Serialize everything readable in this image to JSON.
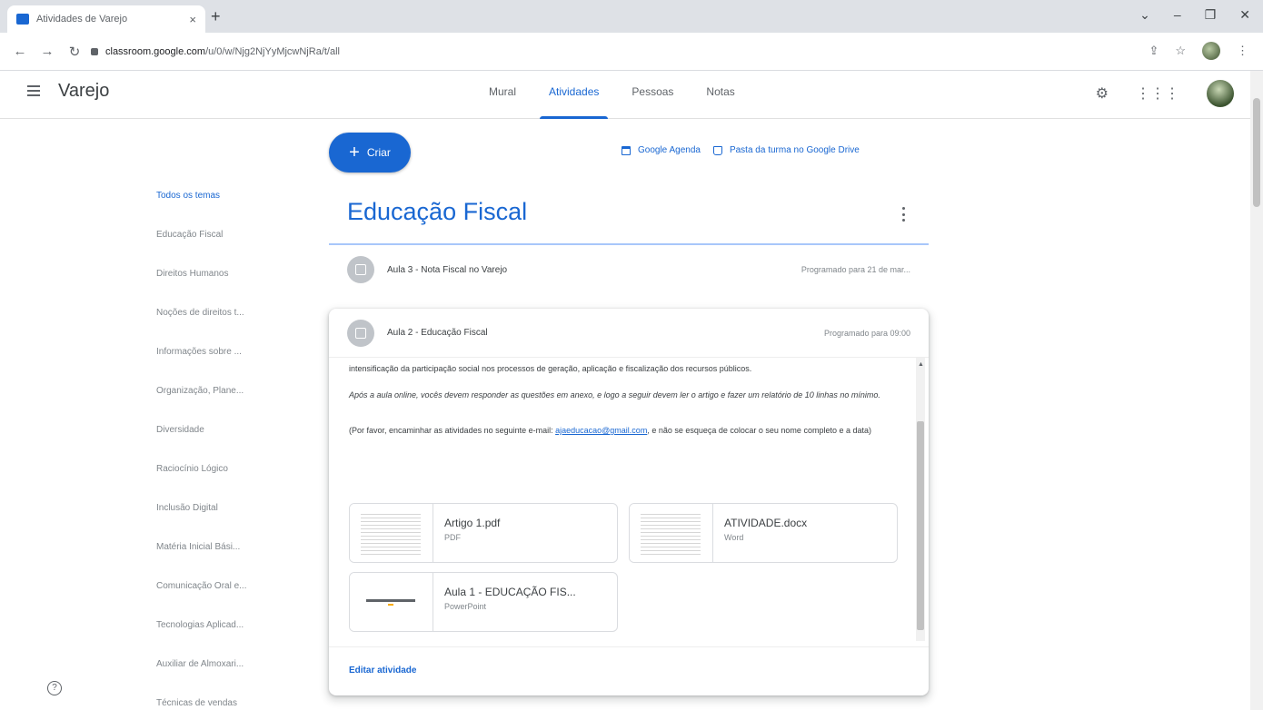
{
  "browser": {
    "tab_title": "Atividades de Varejo",
    "tab_close": "×",
    "new_tab": "+",
    "url_host": "classroom.google.com",
    "url_path": "/u/0/w/Njg2NjYyMjcwNjRa/t/all",
    "window_controls": [
      "⌄",
      "–",
      "❐",
      "✕"
    ]
  },
  "header": {
    "course": "Varejo",
    "tabs": [
      "Mural",
      "Atividades",
      "Pessoas",
      "Notas"
    ],
    "active_tab": "Atividades"
  },
  "actions": {
    "create_label": "Criar",
    "calendar_link": "Google Agenda",
    "drive_link": "Pasta da turma no Google Drive"
  },
  "sidebar": {
    "topics": [
      "Todos os temas",
      "Educação Fiscal",
      "Direitos Humanos",
      "Noções de direitos t...",
      "Informações sobre ...",
      "Organização, Plane...",
      "Diversidade",
      "Raciocínio Lógico",
      "Inclusão Digital",
      "Matéria Inicial Bási...",
      "Comunicação Oral e...",
      "Tecnologias Aplicad...",
      "Auxiliar de Almoxari...",
      "Técnicas de vendas"
    ]
  },
  "section": {
    "title": "Educação Fiscal",
    "assignments": [
      {
        "title": "Aula 3 - Nota Fiscal no Varejo",
        "status": "Programado para 21 de mar..."
      }
    ],
    "expanded": {
      "title": "Aula 2 - Educação Fiscal",
      "status": "Programado para 09:00",
      "paragraph1": "intensificação da participação social nos processos de geração, aplicação e fiscalização dos recursos públicos.",
      "paragraph2": "Após a aula online, vocês devem responder as questões em anexo, e logo a seguir devem ler o artigo e fazer um relatório de 10 linhas no mínimo.",
      "paragraph3_before": "(Por favor, encaminhar as atividades no seguinte e-mail: ",
      "email": "ajaeducacao@gmail.com",
      "paragraph3_after": ", e não se esqueça de colocar o seu nome completo e a data)",
      "attachments": [
        {
          "name": "Artigo 1.pdf",
          "type": "PDF"
        },
        {
          "name": "ATIVIDADE.docx",
          "type": "Word"
        },
        {
          "name": "Aula 1 - EDUCAÇÃO FIS...",
          "type": "PowerPoint"
        }
      ],
      "edit_label": "Editar atividade"
    }
  },
  "colors": {
    "accent": "#1967d2"
  }
}
